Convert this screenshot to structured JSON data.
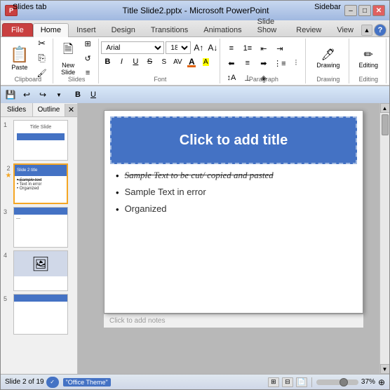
{
  "annotations": {
    "slides_tab": "Slides tab",
    "sidebar": "Sidebar"
  },
  "window": {
    "title": "Title Slide2.pptx - Microsoft PowerPoint"
  },
  "win_controls": {
    "minimize": "–",
    "maximize": "□",
    "close": "✕"
  },
  "ribbon": {
    "tabs": [
      "File",
      "Home",
      "Insert",
      "Design",
      "Transitions",
      "Animations",
      "Slide Show",
      "Review",
      "View"
    ],
    "active_tab": "Home",
    "groups": {
      "clipboard": {
        "label": "Clipboard",
        "paste": "Paste"
      },
      "slides": {
        "label": "Slides",
        "new_slide": "New\nSlide"
      },
      "font": {
        "label": "Font",
        "font_name": "Arial",
        "font_size": "18",
        "bold": "B",
        "italic": "I",
        "underline": "U",
        "strikethrough": "S",
        "shadow": "S"
      },
      "paragraph": {
        "label": "Paragraph"
      },
      "drawing": {
        "label": "Drawing"
      },
      "editing": {
        "label": "Editing"
      }
    }
  },
  "quick_access": {
    "save": "💾",
    "undo": "↩",
    "redo": "↪",
    "dropdown": "▼"
  },
  "slide_panel": {
    "slides_tab": "Slides",
    "outline_tab": "Outline",
    "close": "✕",
    "slides": [
      {
        "num": "1",
        "type": "title"
      },
      {
        "num": "2",
        "type": "content",
        "selected": true
      },
      {
        "num": "3",
        "type": "blank"
      },
      {
        "num": "4",
        "type": "image"
      },
      {
        "num": "5",
        "type": "blank"
      }
    ]
  },
  "main_slide": {
    "title_placeholder": "Click to add title",
    "bullets": [
      {
        "text": "Sample Text to be cut/ copied and pasted",
        "style": "strikethrough-italic"
      },
      {
        "text": "Sample Text in error",
        "style": "normal"
      },
      {
        "text": "Organized",
        "style": "normal"
      }
    ],
    "notes_placeholder": "Click to add notes"
  },
  "status_bar": {
    "slide_info": "Slide 2 of 19",
    "theme": "\"Office Theme\"",
    "zoom": "37%",
    "view_normal": "▦",
    "view_slide_sorter": "⊞",
    "view_reading": "📖"
  }
}
